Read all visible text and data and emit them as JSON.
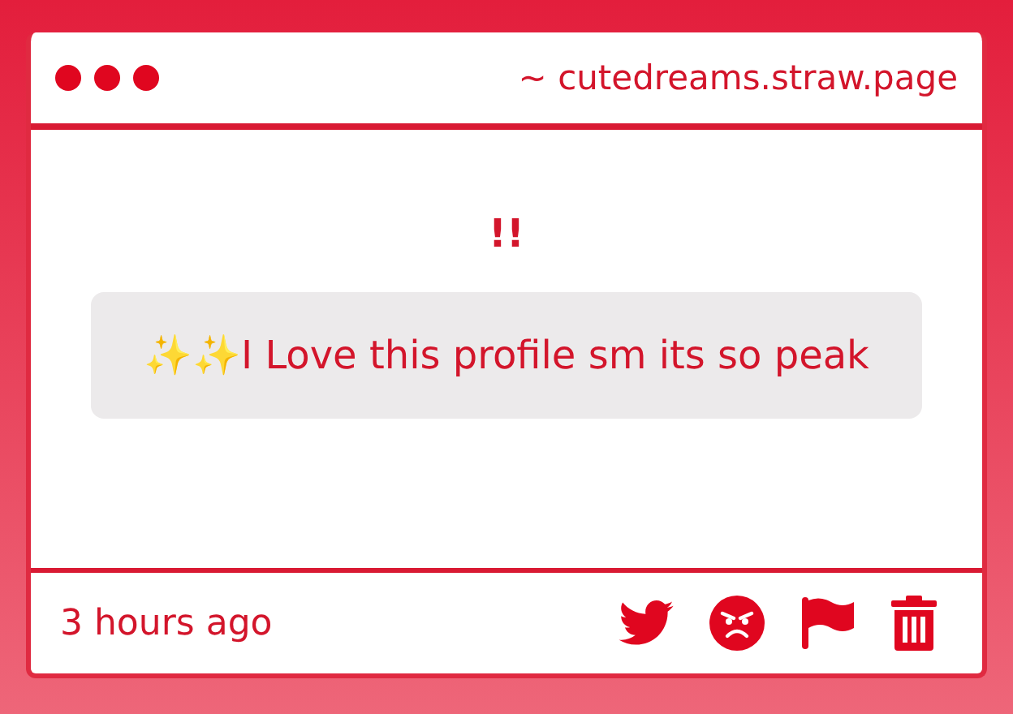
{
  "window": {
    "title": "~ cutedreams.straw.page"
  },
  "message": {
    "heading": "!!",
    "text": "✨✨I Love this profile sm its so peak"
  },
  "footer": {
    "time": "3 hours ago",
    "actions": [
      {
        "kind": "twitter"
      },
      {
        "kind": "angry"
      },
      {
        "kind": "flag"
      },
      {
        "kind": "trash"
      }
    ]
  }
}
